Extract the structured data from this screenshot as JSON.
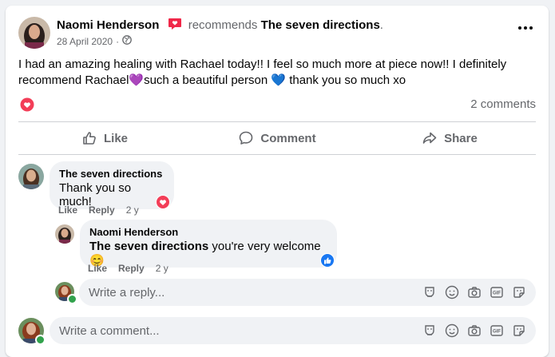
{
  "post": {
    "author": "Naomi Henderson",
    "recommends": "recommends",
    "page_name": "The seven directions",
    "period": ".",
    "date": "28 April 2020",
    "text": "I had an amazing healing with Rachael today!! I feel so much more at piece now!! I definitely recommend Rachael💜such a beautiful person 💙 thank you so much xo",
    "comments_count": "2 comments"
  },
  "actions": {
    "like": "Like",
    "comment": "Comment",
    "share": "Share"
  },
  "comments": [
    {
      "author": "The seven directions",
      "text": "Thank you so much!",
      "like": "Like",
      "reply": "Reply",
      "time": "2 y"
    }
  ],
  "reply": {
    "author": "Naomi Henderson",
    "mention": "The seven directions",
    "text": " you're very welcome 😊",
    "like": "Like",
    "reply": "Reply",
    "time": "2 y"
  },
  "reply_box": {
    "placeholder": "Write a reply..."
  },
  "comment_box": {
    "placeholder": "Write a comment..."
  },
  "colors": {
    "like_blue": "#1877f2",
    "heart_red": "#f33e58",
    "recommend_pink": "#f02849",
    "online_green": "#31a24c"
  }
}
